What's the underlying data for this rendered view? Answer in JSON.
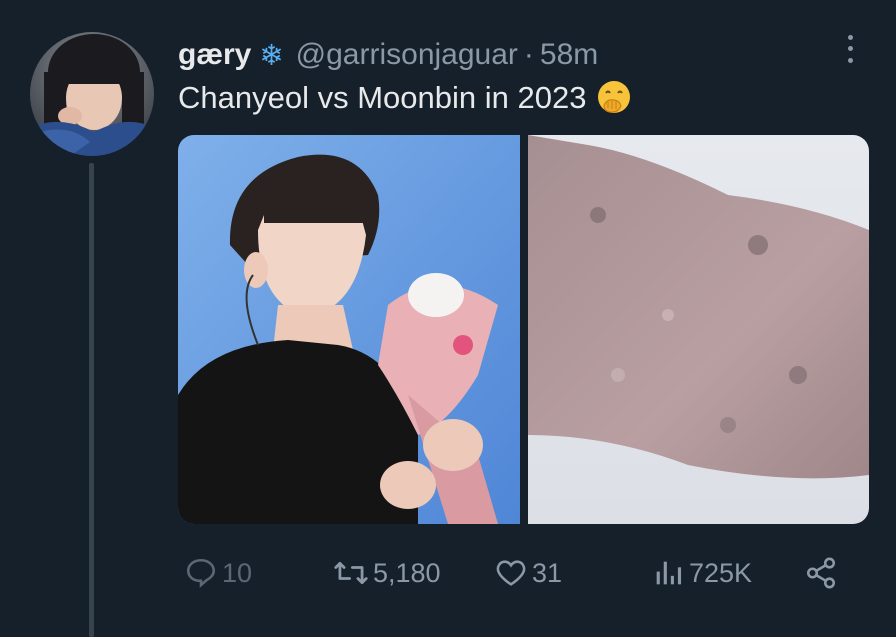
{
  "tweet": {
    "display_name": "gæry",
    "name_badge_icon": "snowflake-icon",
    "handle": "@garrisonjaguar",
    "separator": "·",
    "time": "58m",
    "text": "Chanyeol vs Moonbin in 2023",
    "text_emoji": "face-with-hand-over-mouth-emoji",
    "media": [
      {
        "description_icon": "photo-man-with-flowers"
      },
      {
        "description_icon": "photo-pink-powder"
      }
    ]
  },
  "actions": {
    "reply_count": "10",
    "retweet_count": "5,180",
    "like_count": "31",
    "views_count": "725K"
  },
  "colors": {
    "background": "#15202b",
    "text": "#e7e9ea",
    "muted": "#8b98a5",
    "thread_line": "#38444d"
  }
}
